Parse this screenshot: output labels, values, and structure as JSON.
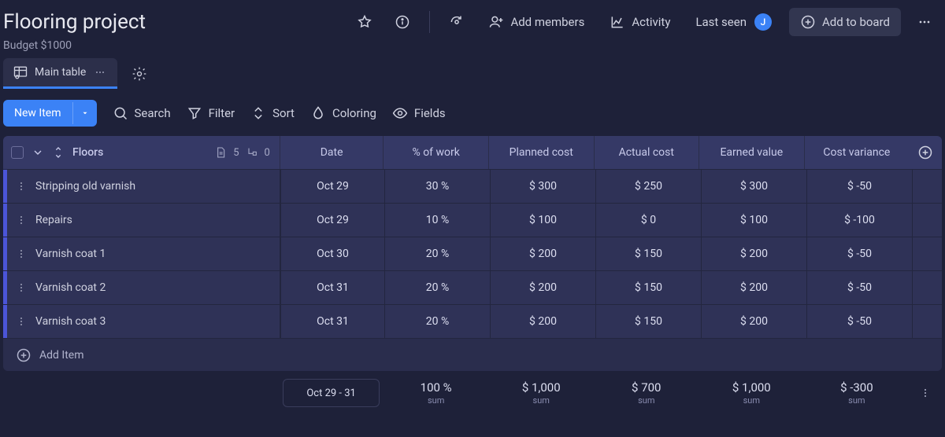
{
  "header": {
    "title": "Flooring project",
    "budget": "Budget $1000",
    "add_members": "Add members",
    "activity": "Activity",
    "last_seen": "Last seen",
    "avatar_initial": "J",
    "add_to_board": "Add to board"
  },
  "tabs": {
    "main": "Main table"
  },
  "toolbar": {
    "new_item": "New Item",
    "search": "Search",
    "filter": "Filter",
    "sort": "Sort",
    "coloring": "Coloring",
    "fields": "Fields"
  },
  "group": {
    "name": "Floors",
    "count_items": "5",
    "count_sub": "0"
  },
  "columns": {
    "date": "Date",
    "pct": "% of work",
    "planned": "Planned cost",
    "actual": "Actual cost",
    "earned": "Earned value",
    "variance": "Cost variance"
  },
  "rows": [
    {
      "name": "Stripping old varnish",
      "date": "Oct 29",
      "pct": "30 %",
      "planned": "$ 300",
      "actual": "$ 250",
      "earned": "$ 300",
      "variance": "$ -50"
    },
    {
      "name": "Repairs",
      "date": "Oct 29",
      "pct": "10 %",
      "planned": "$ 100",
      "actual": "$ 0",
      "earned": "$ 100",
      "variance": "$ -100"
    },
    {
      "name": "Varnish coat 1",
      "date": "Oct 30",
      "pct": "20 %",
      "planned": "$ 200",
      "actual": "$ 150",
      "earned": "$ 200",
      "variance": "$ -50"
    },
    {
      "name": "Varnish coat 2",
      "date": "Oct 31",
      "pct": "20 %",
      "planned": "$ 200",
      "actual": "$ 150",
      "earned": "$ 200",
      "variance": "$ -50"
    },
    {
      "name": "Varnish coat 3",
      "date": "Oct 31",
      "pct": "20 %",
      "planned": "$ 200",
      "actual": "$ 150",
      "earned": "$ 200",
      "variance": "$ -50"
    }
  ],
  "add_item": "Add Item",
  "summary": {
    "date_range": "Oct 29 - 31",
    "pct": "100 %",
    "planned": "$ 1,000",
    "actual": "$ 700",
    "earned": "$ 1,000",
    "variance": "$ -300",
    "label": "sum"
  }
}
